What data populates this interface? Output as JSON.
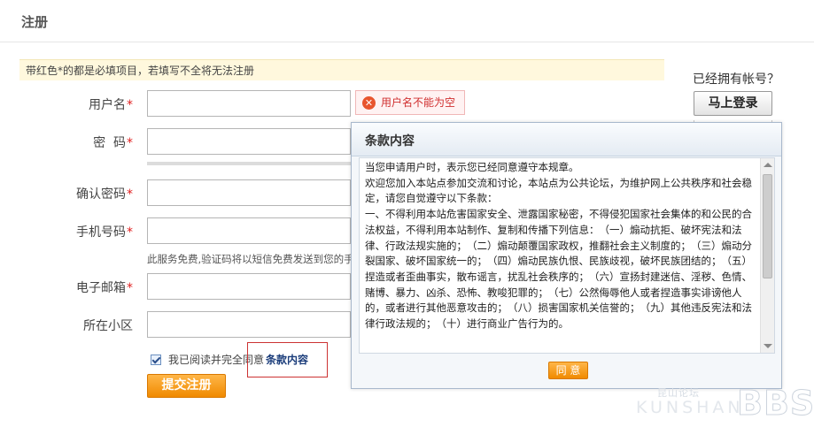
{
  "page": {
    "title": "注册"
  },
  "notice": {
    "text": "带红色*的都是必填项目，若填写不全将无法注册"
  },
  "form": {
    "required_mark": "*",
    "fields": [
      {
        "label": "用户名",
        "required": true,
        "value": ""
      },
      {
        "label": "密  码",
        "required": true,
        "value": ""
      },
      {
        "label": "确认密码",
        "required": true,
        "value": ""
      },
      {
        "label": "手机号码",
        "required": true,
        "value": "",
        "hint": "此服务免费,验证码将以短信免费发送到您的手机"
      },
      {
        "label": "电子邮箱",
        "required": true,
        "value": ""
      },
      {
        "label": "所在小区",
        "required": false,
        "value": ""
      }
    ],
    "username_error": "用户名不能为空",
    "agree_text": "我已阅读并完全同意",
    "agree_checked": true,
    "terms_link": "条款内容",
    "submit_label": "提交注册"
  },
  "sidebar": {
    "question": "已经拥有帐号？",
    "login_label": "马上登录"
  },
  "modal": {
    "title": "条款内容",
    "paragraphs": [
      "当您申请用户时，表示您已经同意遵守本规章。",
      "欢迎您加入本站点参加交流和讨论，本站点为公共论坛，为维护网上公共秩序和社会稳定，请您自觉遵守以下条款：",
      "一、不得利用本站危害国家安全、泄露国家秘密，不得侵犯国家社会集体的和公民的合法权益，不得利用本站制作、复制和传播下列信息：　（一）煽动抗拒、破坏宪法和法律、行政法规实施的；　（二）煽动颠覆国家政权，推翻社会主义制度的；　（三）煽动分裂国家、破坏国家统一的；　（四）煽动民族仇恨、民族歧视，破坏民族团结的；　（五）捏造或者歪曲事实，散布谣言，扰乱社会秩序的；　（六）宣扬封建迷信、淫秽、色情、赌博、暴力、凶杀、恐怖、教唆犯罪的；　（七）公然侮辱他人或者捏造事实诽谤他人的，或者进行其他恶意攻击的；　（八）损害国家机关信誉的；　（九）其他违反宪法和法律行政法规的；　（十）进行商业广告行为的。"
    ],
    "agree_label": "同 意"
  },
  "watermark": {
    "cn": "昆山论坛",
    "en": "KUNSHAN",
    "bbs": "BBS"
  }
}
